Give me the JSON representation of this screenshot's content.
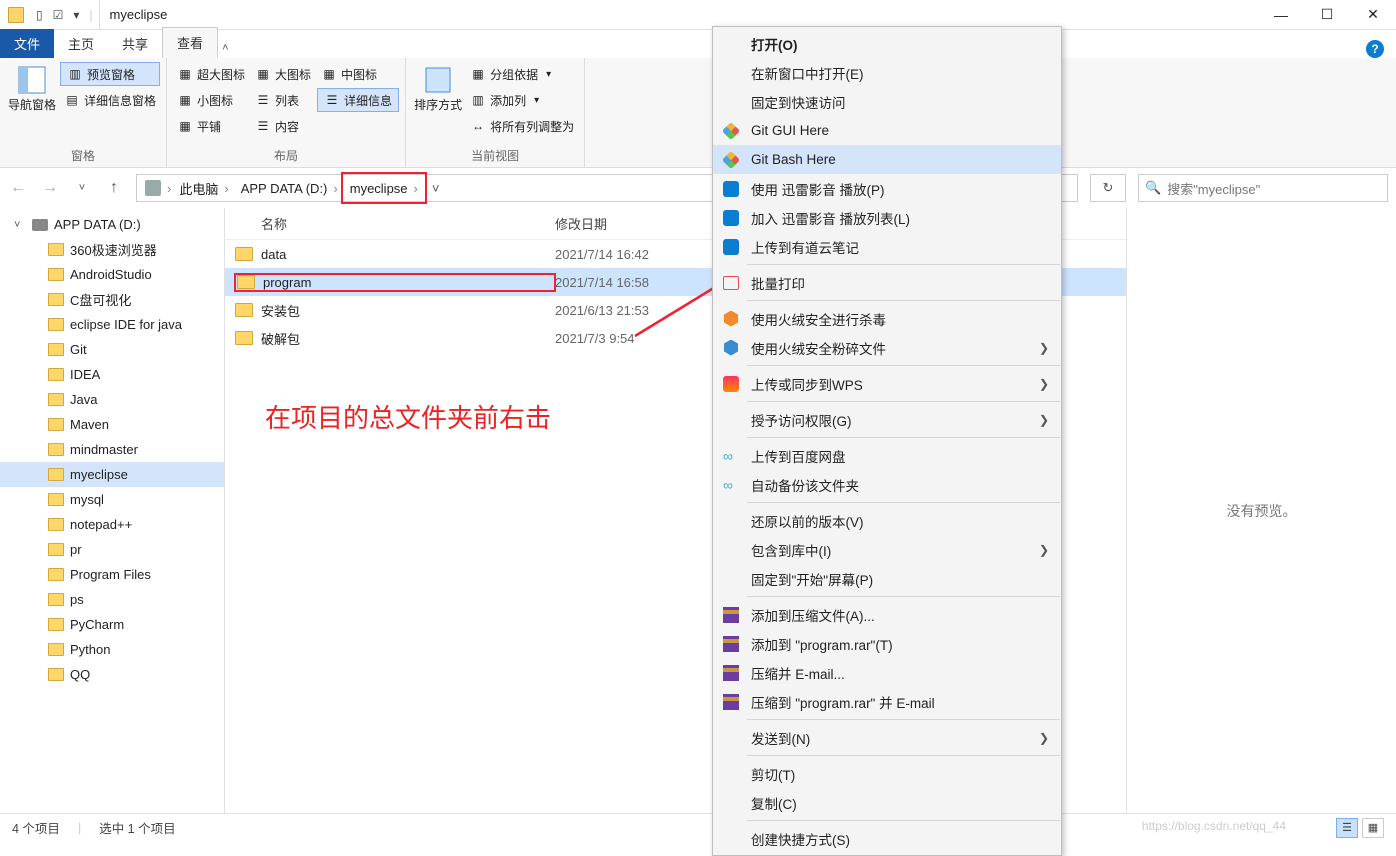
{
  "title": "myeclipse",
  "tabs": {
    "file": "文件",
    "home": "主页",
    "share": "共享",
    "view": "查看"
  },
  "ribbon": {
    "panes": {
      "nav": "导航窗格",
      "preview_pane": "预览窗格",
      "details_pane": "详细信息窗格",
      "group": "窗格"
    },
    "layout": {
      "xl_icons": "超大图标",
      "l_icons": "大图标",
      "m_icons": "中图标",
      "s_icons": "小图标",
      "list": "列表",
      "details": "详细信息",
      "tiles": "平铺",
      "content": "内容",
      "group": "布局"
    },
    "sort": {
      "sort_by": "排序方式",
      "group_by": "分组依据",
      "add_columns": "添加列",
      "fit_columns": "将所有列调整为",
      "group": "当前视图"
    }
  },
  "breadcrumbs": [
    "此电脑",
    "APP DATA (D:)",
    "myeclipse"
  ],
  "search_placeholder": "搜索\"myeclipse\"",
  "columns": {
    "name": "名称",
    "date": "修改日期"
  },
  "tree_drive": "APP DATA (D:)",
  "tree_items": [
    "360极速浏览器",
    "AndroidStudio",
    "C盘可视化",
    "eclipse IDE for java",
    "Git",
    "IDEA",
    "Java",
    "Maven",
    "mindmaster",
    "myeclipse",
    "mysql",
    "notepad++",
    "pr",
    "Program Files",
    "ps",
    "PyCharm",
    "Python",
    "QQ"
  ],
  "list_items": [
    {
      "name": "data",
      "date": "2021/7/14 16:42",
      "selected": false
    },
    {
      "name": "program",
      "date": "2021/7/14 16:58",
      "selected": true
    },
    {
      "name": "安装包",
      "date": "2021/6/13 21:53",
      "selected": false
    },
    {
      "name": "破解包",
      "date": "2021/7/3 9:54",
      "selected": false
    }
  ],
  "preview_text": "没有预览。",
  "annotation": "在项目的总文件夹前右击",
  "status": {
    "count": "4 个项目",
    "selected": "选中 1 个项目"
  },
  "watermark": "https://blog.csdn.net/qq_44",
  "context_menu": [
    {
      "label": "打开(O)",
      "bold": true
    },
    {
      "label": "在新窗口中打开(E)"
    },
    {
      "label": "固定到快速访问"
    },
    {
      "label": "Git GUI Here",
      "icon": "git"
    },
    {
      "label": "Git Bash Here",
      "icon": "git",
      "hl": true
    },
    {
      "label": "使用 迅雷影音 播放(P)",
      "icon": "xunlei"
    },
    {
      "label": "加入 迅雷影音 播放列表(L)",
      "icon": "xunlei"
    },
    {
      "label": "上传到有道云笔记",
      "icon": "note"
    },
    {
      "sep": true
    },
    {
      "label": "批量打印",
      "icon": "print"
    },
    {
      "sep": true
    },
    {
      "label": "使用火绒安全进行杀毒",
      "icon": "huorong"
    },
    {
      "label": "使用火绒安全粉碎文件",
      "icon": "huorong-blue",
      "sub": true
    },
    {
      "sep": true
    },
    {
      "label": "上传或同步到WPS",
      "icon": "wps",
      "sub": true
    },
    {
      "sep": true
    },
    {
      "label": "授予访问权限(G)",
      "sub": true
    },
    {
      "sep": true
    },
    {
      "label": "上传到百度网盘",
      "icon": "baidu"
    },
    {
      "label": "自动备份该文件夹",
      "icon": "baidu"
    },
    {
      "sep": true
    },
    {
      "label": "还原以前的版本(V)"
    },
    {
      "label": "包含到库中(I)",
      "sub": true
    },
    {
      "label": "固定到\"开始\"屏幕(P)"
    },
    {
      "sep": true
    },
    {
      "label": "添加到压缩文件(A)...",
      "icon": "rar"
    },
    {
      "label": "添加到 \"program.rar\"(T)",
      "icon": "rar"
    },
    {
      "label": "压缩并 E-mail...",
      "icon": "rar"
    },
    {
      "label": "压缩到 \"program.rar\" 并 E-mail",
      "icon": "rar"
    },
    {
      "sep": true
    },
    {
      "label": "发送到(N)",
      "sub": true
    },
    {
      "sep": true
    },
    {
      "label": "剪切(T)"
    },
    {
      "label": "复制(C)"
    },
    {
      "sep": true
    },
    {
      "label": "创建快捷方式(S)"
    }
  ]
}
